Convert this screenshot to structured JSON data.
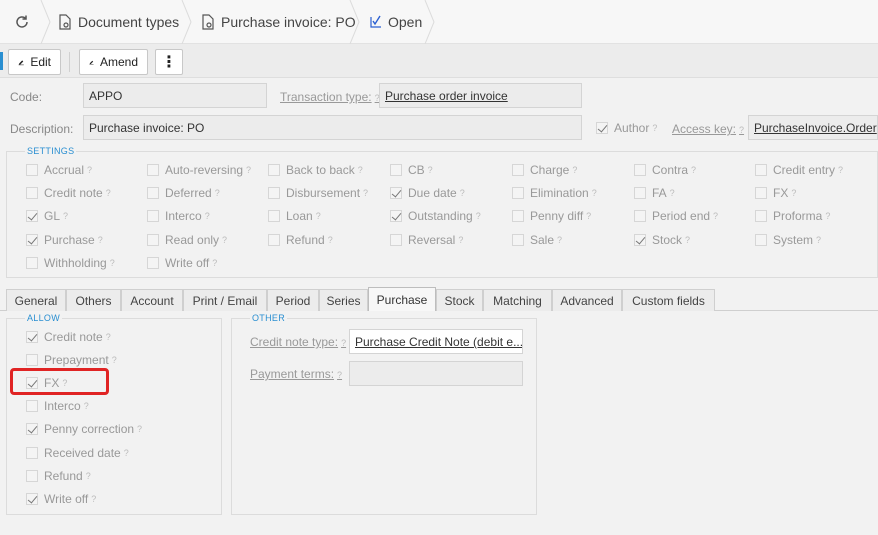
{
  "breadcrumbs": {
    "doc_types": "Document types",
    "record": "Purchase invoice: PO",
    "open": "Open"
  },
  "toolbar": {
    "edit": "Edit",
    "amend": "Amend",
    "more": "⋮"
  },
  "header": {
    "code_label": "Code:",
    "code_value": "APPO",
    "transaction_type_label": "Transaction type:",
    "transaction_type_value": "Purchase order invoice",
    "description_label": "Description:",
    "description_value": "Purchase invoice: PO",
    "author_label": "Author",
    "author_checked": true,
    "access_key_label": "Access key:",
    "access_key_value": "PurchaseInvoice.Order"
  },
  "settings": {
    "title": "SETTINGS",
    "items": [
      {
        "label": "Accrual",
        "checked": false
      },
      {
        "label": "Auto-reversing",
        "checked": false
      },
      {
        "label": "Back to back",
        "checked": false
      },
      {
        "label": "CB",
        "checked": false
      },
      {
        "label": "Charge",
        "checked": false
      },
      {
        "label": "Contra",
        "checked": false
      },
      {
        "label": "Credit entry",
        "checked": false
      },
      {
        "label": "Credit note",
        "checked": false
      },
      {
        "label": "Deferred",
        "checked": false
      },
      {
        "label": "Disbursement",
        "checked": false
      },
      {
        "label": "Due date",
        "checked": true
      },
      {
        "label": "Elimination",
        "checked": false
      },
      {
        "label": "FA",
        "checked": false
      },
      {
        "label": "FX",
        "checked": false
      },
      {
        "label": "GL",
        "checked": true
      },
      {
        "label": "Interco",
        "checked": false
      },
      {
        "label": "Loan",
        "checked": false
      },
      {
        "label": "Outstanding",
        "checked": true
      },
      {
        "label": "Penny diff",
        "checked": false
      },
      {
        "label": "Period end",
        "checked": false
      },
      {
        "label": "Proforma",
        "checked": false
      },
      {
        "label": "Purchase",
        "checked": true
      },
      {
        "label": "Read only",
        "checked": false
      },
      {
        "label": "Refund",
        "checked": false
      },
      {
        "label": "Reversal",
        "checked": false
      },
      {
        "label": "Sale",
        "checked": false
      },
      {
        "label": "Stock",
        "checked": true
      },
      {
        "label": "System",
        "checked": false
      },
      {
        "label": "Withholding",
        "checked": false
      },
      {
        "label": "Write off",
        "checked": false
      }
    ]
  },
  "tabs": [
    {
      "label": "General"
    },
    {
      "label": "Others"
    },
    {
      "label": "Account"
    },
    {
      "label": "Print / Email"
    },
    {
      "label": "Period"
    },
    {
      "label": "Series"
    },
    {
      "label": "Purchase",
      "active": true
    },
    {
      "label": "Stock"
    },
    {
      "label": "Matching"
    },
    {
      "label": "Advanced"
    },
    {
      "label": "Custom fields"
    }
  ],
  "allow": {
    "title": "ALLOW",
    "items": [
      {
        "label": "Credit note",
        "checked": true
      },
      {
        "label": "Prepayment",
        "checked": false
      },
      {
        "label": "FX",
        "checked": true
      },
      {
        "label": "Interco",
        "checked": false
      },
      {
        "label": "Penny correction",
        "checked": true
      },
      {
        "label": "Received date",
        "checked": false
      },
      {
        "label": "Refund",
        "checked": false
      },
      {
        "label": "Write off",
        "checked": true
      }
    ]
  },
  "other": {
    "title": "OTHER",
    "credit_note_type_label": "Credit note type:",
    "credit_note_type_value": "Purchase Credit Note (debit e...",
    "payment_terms_label": "Payment terms:",
    "payment_terms_value": ""
  },
  "colors": {
    "accent": "#2a8fd1",
    "highlight": "#e02424"
  }
}
